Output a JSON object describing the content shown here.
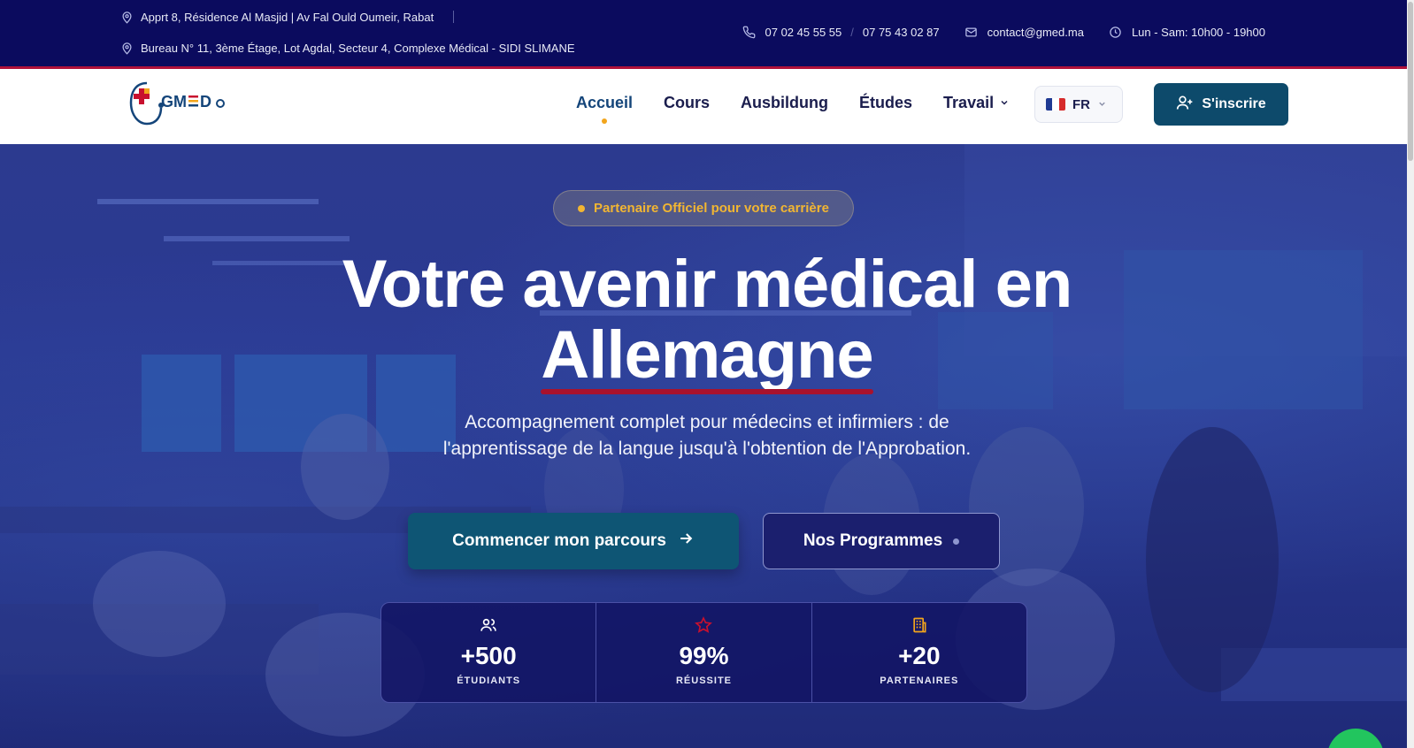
{
  "topbar": {
    "address1": "Apprt 8, Résidence Al Masjid | Av Fal Ould Oumeir, Rabat",
    "address2": "Bureau N° 11, 3ème Étage, Lot Agdal, Secteur 4, Complexe Médical - SIDI SLIMANE",
    "phone1": "07 02 45 55 55",
    "phone_separator": "/",
    "phone2": "07 75 43 02 87",
    "email": "contact@gmed.ma",
    "hours": "Lun - Sam: 10h00 - 19h00",
    "icons": [
      "map-pin-icon",
      "phone-icon",
      "mail-icon",
      "clock-icon"
    ],
    "background_color": "#0b0b5e",
    "accent_line_color": "#b0123a"
  },
  "nav": {
    "logo_text": "GMED",
    "items": [
      {
        "label": "Accueil",
        "active": true
      },
      {
        "label": "Cours"
      },
      {
        "label": "Ausbildung"
      },
      {
        "label": "Études"
      },
      {
        "label": "Travail",
        "has_dropdown": true
      }
    ],
    "language": "FR",
    "signup_label": "S'inscrire",
    "signup_color": "#0d4a6b",
    "active_dot_color": "#f2a51c"
  },
  "hero": {
    "badge": "Partenaire Officiel pour votre carrière",
    "headline_line1": "Votre avenir médical en",
    "headline_line2": "Allemagne",
    "subtitle_line1": "Accompagnement complet pour médecins et infirmiers : de",
    "subtitle_line2": "l'apprentissage de la langue jusqu'à l'obtention de l'Approbation.",
    "cta_primary": "Commencer mon parcours",
    "cta_secondary": "Nos Programmes",
    "badge_color": "#f2b632",
    "underline_color": "#a8122d"
  },
  "stats": [
    {
      "icon": "users-icon",
      "value": "+500",
      "label": "ÉTUDIANTS",
      "icon_color": "#ffffff"
    },
    {
      "icon": "star-icon",
      "value": "99%",
      "label": "RÉUSSITE",
      "icon_color": "#c8102e"
    },
    {
      "icon": "building-icon",
      "value": "+20",
      "label": "PARTENAIRES",
      "icon_color": "#f2a51c"
    }
  ]
}
